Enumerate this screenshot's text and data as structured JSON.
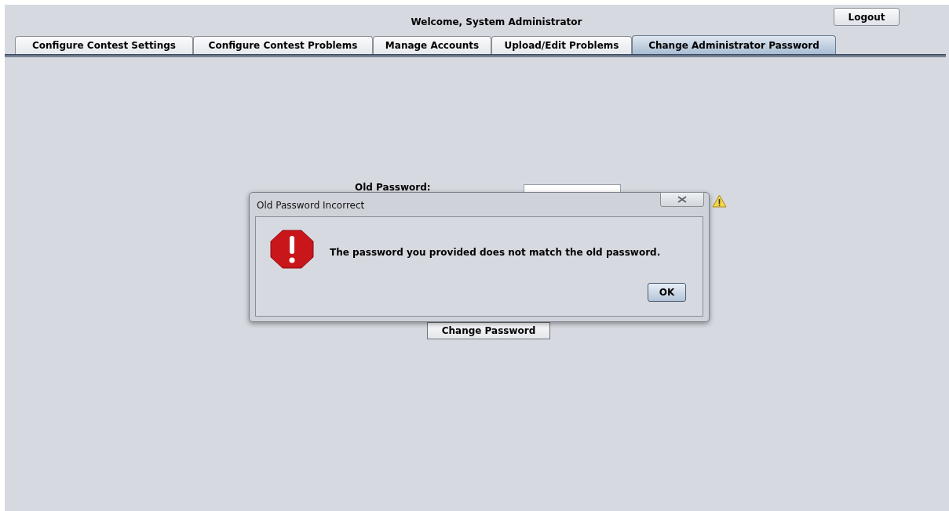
{
  "header": {
    "welcome": "Welcome, System Administrator",
    "logout_button": "Logout"
  },
  "tabs": [
    {
      "label": "Configure Contest Settings",
      "selected": false
    },
    {
      "label": "Configure Contest Problems",
      "selected": false
    },
    {
      "label": "Manage Accounts",
      "selected": false
    },
    {
      "label": "Upload/Edit Problems",
      "selected": false
    },
    {
      "label": "Change Administrator Password",
      "selected": true
    }
  ],
  "form": {
    "old_password_label": "Old Password:",
    "change_password_button": "Change Password"
  },
  "dialog": {
    "title": "Old Password Incorrect",
    "message": "The password you provided does not match the old password.",
    "ok_button": "OK"
  }
}
